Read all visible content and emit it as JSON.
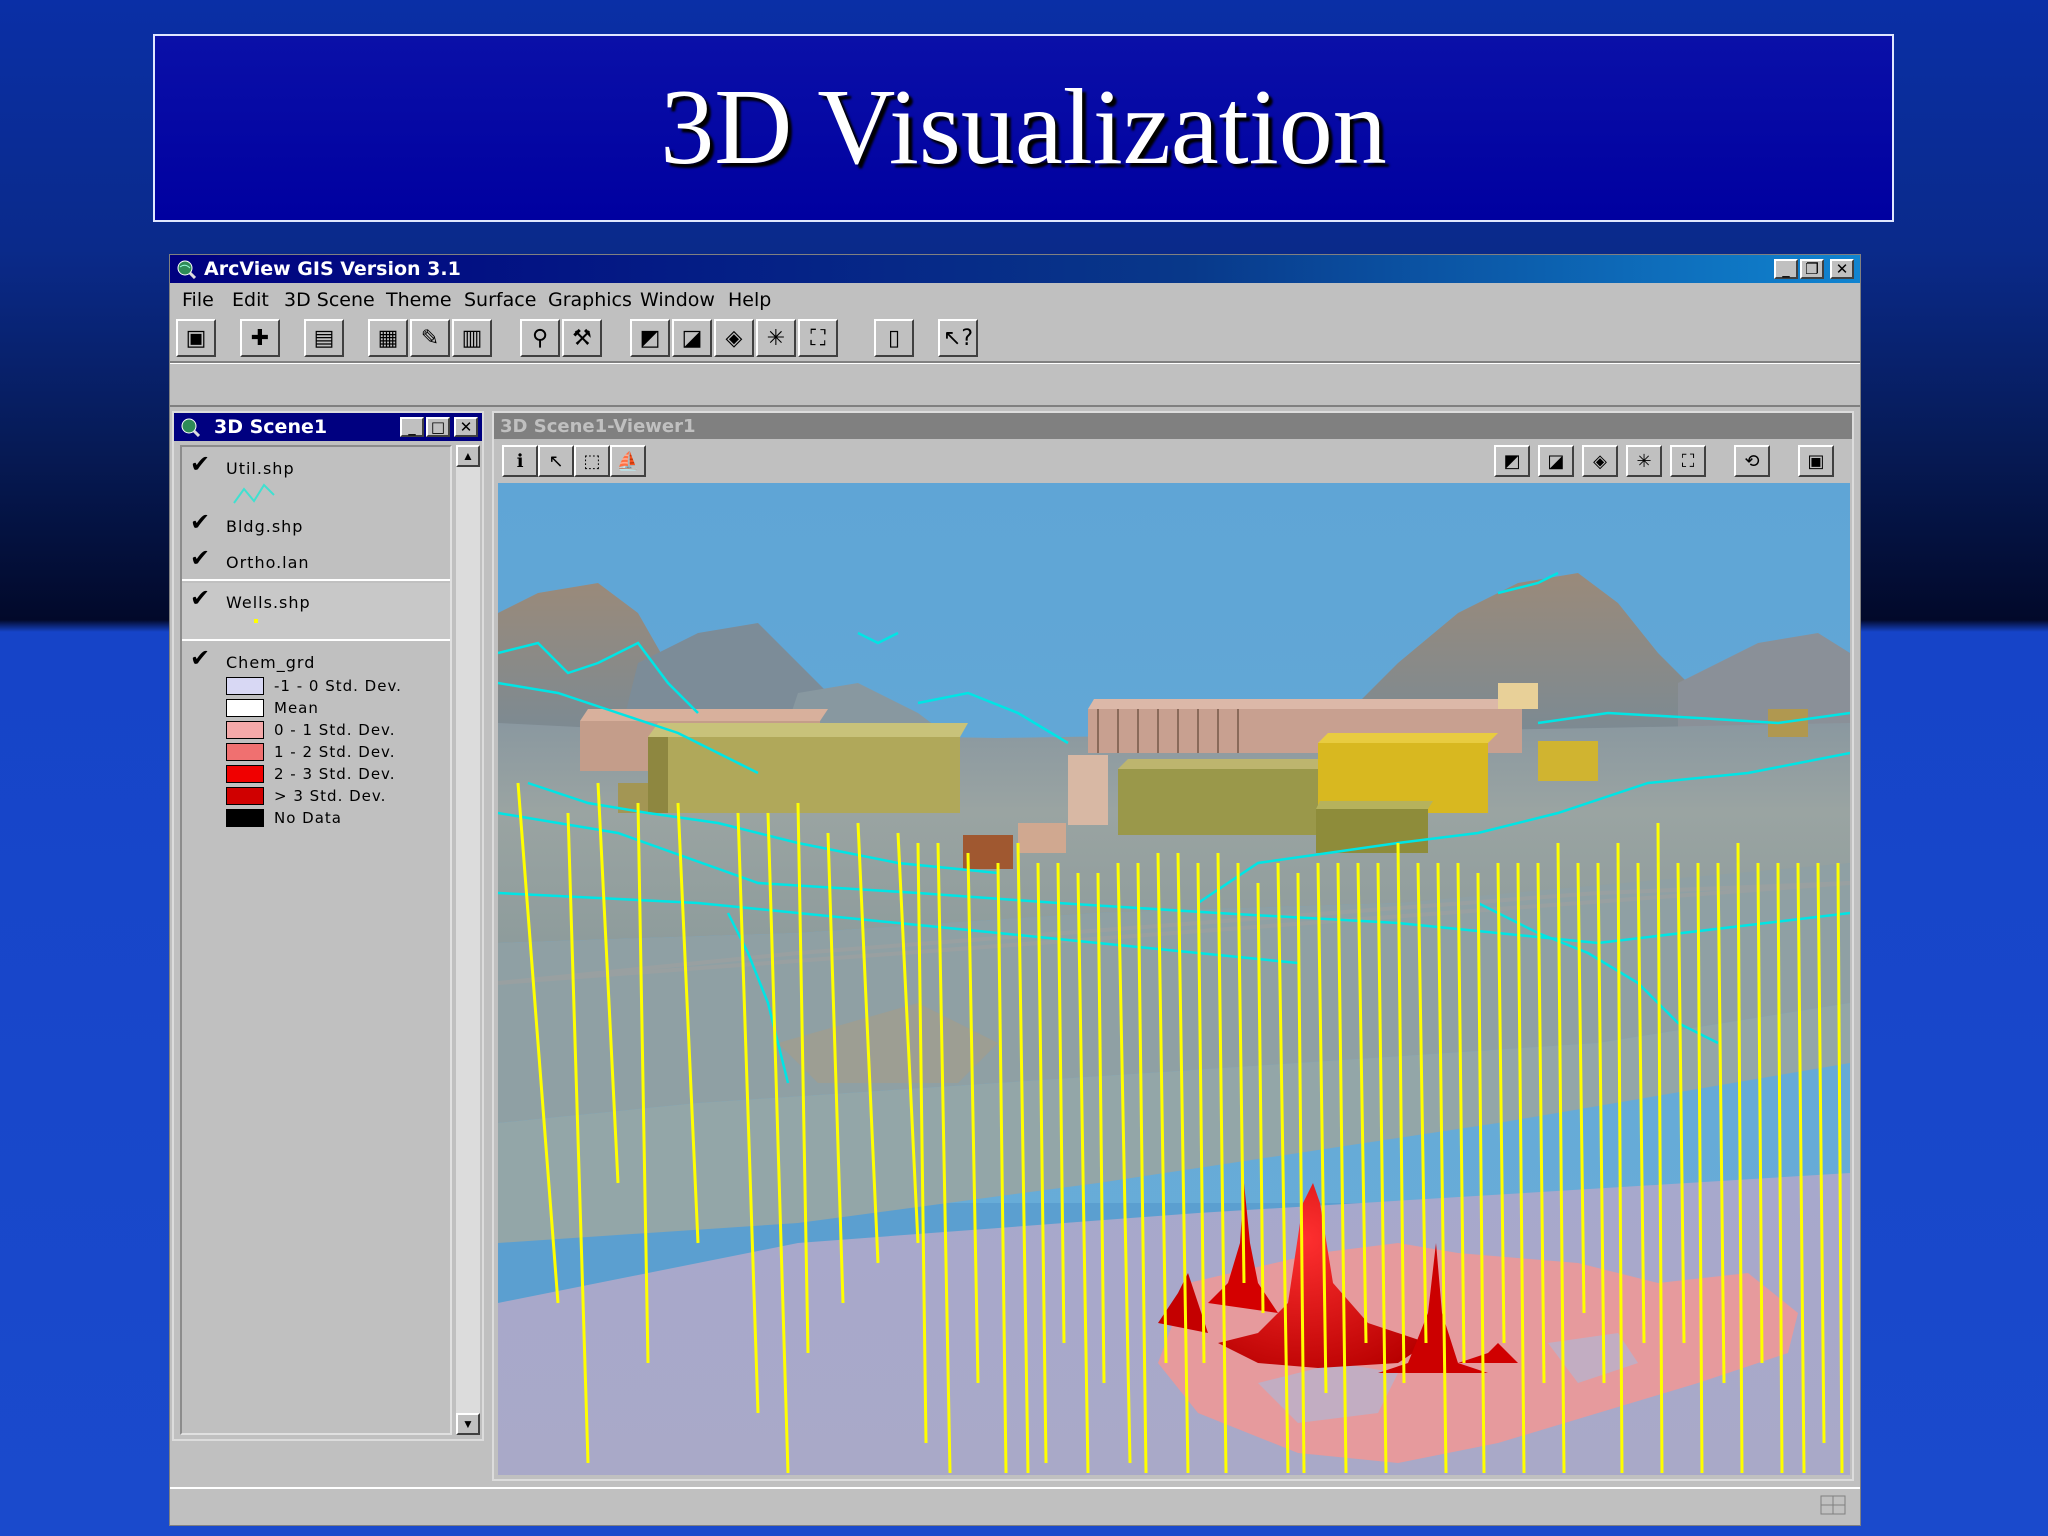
{
  "slide": {
    "title": "3D Visualization"
  },
  "app": {
    "title": "ArcView GIS Version 3.1",
    "menu": [
      "File",
      "Edit",
      "3D Scene",
      "Theme",
      "Surface",
      "Graphics",
      "Window",
      "Help"
    ],
    "toolbar_icons": [
      "save-icon",
      "add-theme-icon",
      "window-icon",
      "theme-properties-icon",
      "edit-legend-icon",
      "open-table-icon",
      "find-icon",
      "query-builder-icon",
      "zoom-in-icon",
      "zoom-out-icon",
      "zoom-to-active-icon",
      "zoom-in-scale-icon",
      "zoom-to-full-icon",
      "layout-icon",
      "help-icon"
    ]
  },
  "scene_window": {
    "title": "3D Scene1",
    "themes": [
      {
        "name": "Util.shp"
      },
      {
        "name": "Bldg.shp"
      },
      {
        "name": "Ortho.lan"
      },
      {
        "name": "Wells.shp"
      },
      {
        "name": "Chem_grd"
      }
    ],
    "legend": [
      {
        "label": "-1 - 0 Std. Dev.",
        "color": "#d8d8f4"
      },
      {
        "label": "Mean",
        "color": "#ffffff"
      },
      {
        "label": "0 - 1 Std. Dev.",
        "color": "#f4a8a8"
      },
      {
        "label": "1 - 2 Std. Dev.",
        "color": "#f07070"
      },
      {
        "label": "2 - 3 Std. Dev.",
        "color": "#f00000"
      },
      {
        "label": "> 3 Std. Dev.",
        "color": "#d00000"
      },
      {
        "label": "No Data",
        "color": "#000000"
      }
    ]
  },
  "viewer": {
    "title": "3D Scene1-Viewer1",
    "left_tools": [
      "identify-icon",
      "select-icon",
      "select-graphics-icon",
      "navigate-icon"
    ],
    "right_tools": [
      "zoom-in-icon",
      "zoom-out-icon",
      "zoom-to-active-icon",
      "zoom-in-scale-icon",
      "zoom-to-full-icon",
      "rotate-icon",
      "save-icon"
    ]
  },
  "colors": {
    "sky": "#5fa5d6",
    "wells": "#ffff00",
    "utilities": "#00e5e5",
    "plume": "#e00000"
  }
}
